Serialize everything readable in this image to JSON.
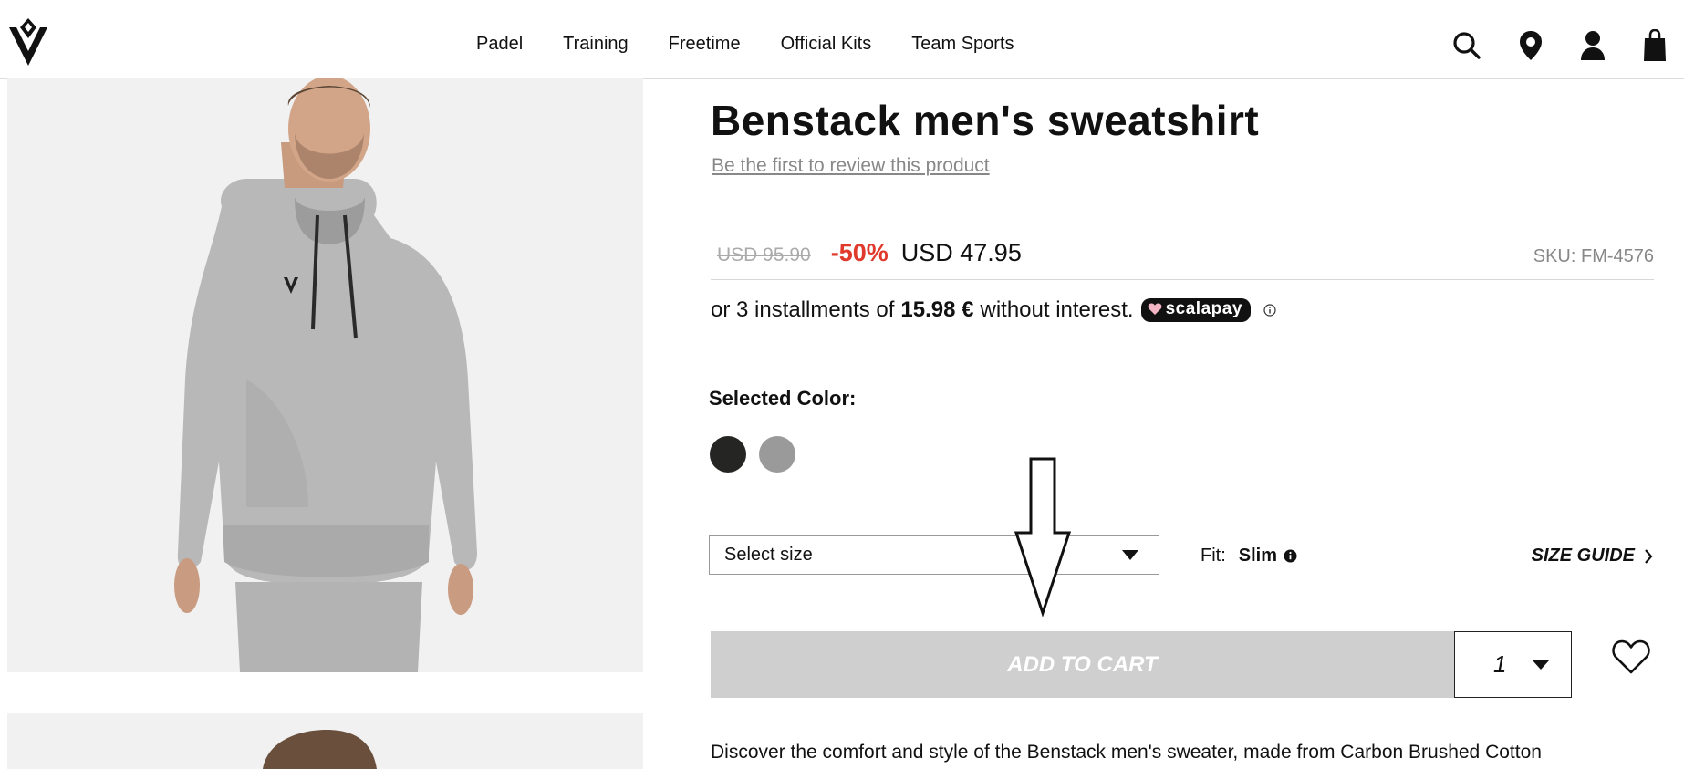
{
  "nav": {
    "items": [
      "Padel",
      "Training",
      "Freetime",
      "Official Kits",
      "Team Sports"
    ]
  },
  "header_icons": [
    "search-icon",
    "location-pin-icon",
    "account-icon",
    "shopping-bag-icon"
  ],
  "product": {
    "title": "Benstack men's sweatshirt",
    "review_link": "Be the first to review this product",
    "old_price": "USD 95.90",
    "discount": "-50%",
    "price": "USD 47.95",
    "sku": "SKU: FM-4576",
    "installments": {
      "prefix": "or 3 installments of",
      "amount": "15.98 €",
      "suffix": "without interest.",
      "provider": "scalapay"
    },
    "color_label": "Selected Color:",
    "colors": [
      {
        "name": "black",
        "hex": "#252523"
      },
      {
        "name": "grey",
        "hex": "#9a9a9a"
      }
    ],
    "size_placeholder": "Select size",
    "fit_label": "Fit:",
    "fit_value": "Slim",
    "size_guide": "SIZE GUIDE",
    "add_to_cart": "ADD TO CART",
    "quantity": "1",
    "description": "Discover the comfort and style of the Benstack men's sweater, made from Carbon Brushed Cotton"
  },
  "colors": {
    "discount_red": "#e03a2c",
    "button_disabled": "#cfcfcf",
    "gallery_bg": "#f1f1f1"
  }
}
